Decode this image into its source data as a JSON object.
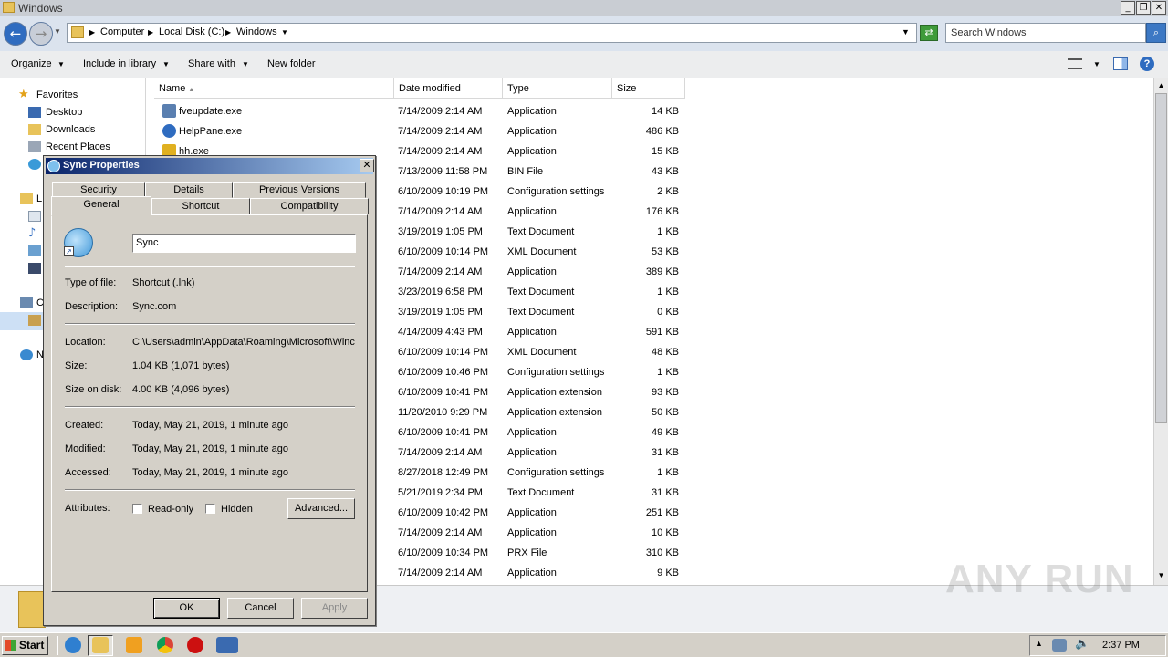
{
  "window": {
    "title": "Windows"
  },
  "address": {
    "crumbs": [
      "Computer",
      "Local Disk (C:)",
      "Windows"
    ],
    "search_placeholder": "Search Windows"
  },
  "toolbar": {
    "organize": "Organize",
    "include": "Include in library",
    "share": "Share with",
    "newfolder": "New folder"
  },
  "nav": {
    "favorites": "Favorites",
    "items": [
      "Desktop",
      "Downloads",
      "Recent Places"
    ],
    "partial": [
      "L",
      "C",
      "N"
    ]
  },
  "columns": {
    "name": "Name",
    "date": "Date modified",
    "type": "Type",
    "size": "Size"
  },
  "files": [
    {
      "name": "fveupdate.exe",
      "date": "7/14/2009 2:14 AM",
      "type": "Application",
      "size": "14 KB"
    },
    {
      "name": "HelpPane.exe",
      "date": "7/14/2009 2:14 AM",
      "type": "Application",
      "size": "486 KB"
    },
    {
      "name": "hh.exe",
      "date": "7/14/2009 2:14 AM",
      "type": "Application",
      "size": "15 KB"
    },
    {
      "name": "",
      "date": "7/13/2009 11:58 PM",
      "type": "BIN File",
      "size": "43 KB"
    },
    {
      "name": "",
      "date": "6/10/2009 10:19 PM",
      "type": "Configuration settings",
      "size": "2 KB"
    },
    {
      "name": "",
      "date": "7/14/2009 2:14 AM",
      "type": "Application",
      "size": "176 KB"
    },
    {
      "name": "",
      "date": "3/19/2019 1:05 PM",
      "type": "Text Document",
      "size": "1 KB"
    },
    {
      "name": "",
      "date": "6/10/2009 10:14 PM",
      "type": "XML Document",
      "size": "53 KB"
    },
    {
      "name": "",
      "date": "7/14/2009 2:14 AM",
      "type": "Application",
      "size": "389 KB"
    },
    {
      "name": "",
      "date": "3/23/2019 6:58 PM",
      "type": "Text Document",
      "size": "1 KB"
    },
    {
      "name": "",
      "date": "3/19/2019 1:05 PM",
      "type": "Text Document",
      "size": "0 KB"
    },
    {
      "name": "",
      "date": "4/14/2009 4:43 PM",
      "type": "Application",
      "size": "591 KB"
    },
    {
      "name": "",
      "date": "6/10/2009 10:14 PM",
      "type": "XML Document",
      "size": "48 KB"
    },
    {
      "name": "",
      "date": "6/10/2009 10:46 PM",
      "type": "Configuration settings",
      "size": "1 KB"
    },
    {
      "name": "",
      "date": "6/10/2009 10:41 PM",
      "type": "Application extension",
      "size": "93 KB"
    },
    {
      "name": "",
      "date": "11/20/2010 9:29 PM",
      "type": "Application extension",
      "size": "50 KB"
    },
    {
      "name": "",
      "date": "6/10/2009 10:41 PM",
      "type": "Application",
      "size": "49 KB"
    },
    {
      "name": "",
      "date": "7/14/2009 2:14 AM",
      "type": "Application",
      "size": "31 KB"
    },
    {
      "name": "",
      "date": "8/27/2018 12:49 PM",
      "type": "Configuration settings",
      "size": "1 KB"
    },
    {
      "name": "",
      "date": "5/21/2019 2:34 PM",
      "type": "Text Document",
      "size": "31 KB"
    },
    {
      "name": "",
      "date": "6/10/2009 10:42 PM",
      "type": "Application",
      "size": "251 KB"
    },
    {
      "name": "",
      "date": "7/14/2009 2:14 AM",
      "type": "Application",
      "size": "10 KB"
    },
    {
      "name": "",
      "date": "6/10/2009 10:34 PM",
      "type": "PRX File",
      "size": "310 KB"
    },
    {
      "name": "",
      "date": "7/14/2009 2:14 AM",
      "type": "Application",
      "size": "9 KB"
    }
  ],
  "dialog": {
    "title": "Sync Properties",
    "tabs_back": [
      "Security",
      "Details",
      "Previous Versions"
    ],
    "tabs_front": [
      "General",
      "Shortcut",
      "Compatibility"
    ],
    "name_value": "Sync",
    "rows1": [
      {
        "label": "Type of file:",
        "value": "Shortcut (.lnk)"
      },
      {
        "label": "Description:",
        "value": "Sync.com"
      }
    ],
    "rows2": [
      {
        "label": "Location:",
        "value": "C:\\Users\\admin\\AppData\\Roaming\\Microsoft\\Winc"
      },
      {
        "label": "Size:",
        "value": "1.04 KB (1,071 bytes)"
      },
      {
        "label": "Size on disk:",
        "value": "4.00 KB (4,096 bytes)"
      }
    ],
    "rows3": [
      {
        "label": "Created:",
        "value": "Today, May 21, 2019, 1 minute ago"
      },
      {
        "label": "Modified:",
        "value": "Today, May 21, 2019, 1 minute ago"
      },
      {
        "label": "Accessed:",
        "value": "Today, May 21, 2019, 1 minute ago"
      }
    ],
    "attributes_label": "Attributes:",
    "readonly": "Read-only",
    "hidden": "Hidden",
    "advanced": "Advanced...",
    "ok": "OK",
    "cancel": "Cancel",
    "apply": "Apply"
  },
  "taskbar": {
    "start": "Start",
    "clock": "2:37 PM"
  },
  "watermark": "ANY RUN",
  "colors": {
    "accent": "#0a246a",
    "explorer_bar": "#dbe3ee",
    "dialog_face": "#d4d0c8"
  }
}
